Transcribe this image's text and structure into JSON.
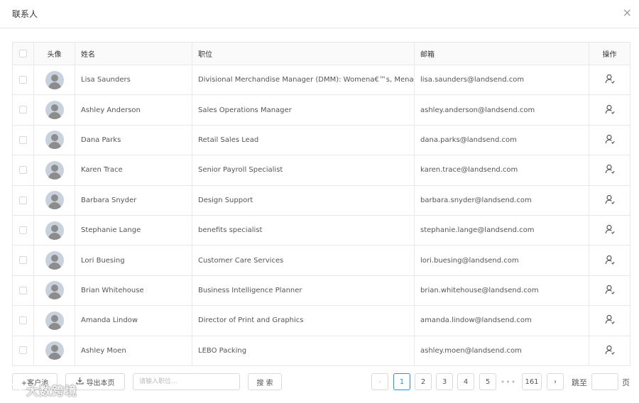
{
  "dialog": {
    "title": "联系人",
    "close_glyph": "×"
  },
  "table": {
    "columns": {
      "avatar": "头像",
      "name": "姓名",
      "position": "职位",
      "email": "邮箱",
      "action": "操作"
    },
    "rows": [
      {
        "name": "Lisa Saunders",
        "position": "Divisional Merchandise Manager (DMM): Womena€™s, Mena€™s, ",
        "email": "lisa.saunders@landsend.com"
      },
      {
        "name": "Ashley Anderson",
        "position": "Sales Operations Manager",
        "email": "ashley.anderson@landsend.com"
      },
      {
        "name": "Dana Parks",
        "position": "Retail Sales Lead",
        "email": "dana.parks@landsend.com"
      },
      {
        "name": "Karen Trace",
        "position": "Senior Payroll Specialist",
        "email": "karen.trace@landsend.com"
      },
      {
        "name": "Barbara Snyder",
        "position": "Design Support",
        "email": "barbara.snyder@landsend.com"
      },
      {
        "name": "Stephanie Lange",
        "position": "benefits specialist",
        "email": "stephanie.lange@landsend.com"
      },
      {
        "name": "Lori Buesing",
        "position": "Customer Care Services",
        "email": "lori.buesing@landsend.com"
      },
      {
        "name": "Brian Whitehouse",
        "position": "Business Intelligence Planner",
        "email": "brian.whitehouse@landsend.com"
      },
      {
        "name": "Amanda Lindow",
        "position": "Director of Print and Graphics",
        "email": "amanda.lindow@landsend.com"
      },
      {
        "name": "Ashley Moen",
        "position": "LEBO Packing",
        "email": "ashley.moen@landsend.com"
      }
    ],
    "row_action_icon": "user-icon",
    "avatar_icon": "default-avatar-icon"
  },
  "footer": {
    "customer_pool_label": "+客户池",
    "export_label": "导出本页",
    "export_icon": "download-icon",
    "search_placeholder": "请输入职位...",
    "search_button": "搜 索",
    "pagination": {
      "prev_glyph": "‹",
      "next_glyph": "›",
      "pages": [
        "1",
        "2",
        "3",
        "4",
        "5"
      ],
      "active_page": "1",
      "ellipsis": "•••",
      "last_page": "161",
      "jump_label": "跳至",
      "page_unit": "页"
    }
  },
  "watermark": {
    "text": "大数跨境"
  },
  "colors": {
    "accent": "#1890ff",
    "border": "#e8e8e8",
    "header_bg": "#fafafa"
  }
}
